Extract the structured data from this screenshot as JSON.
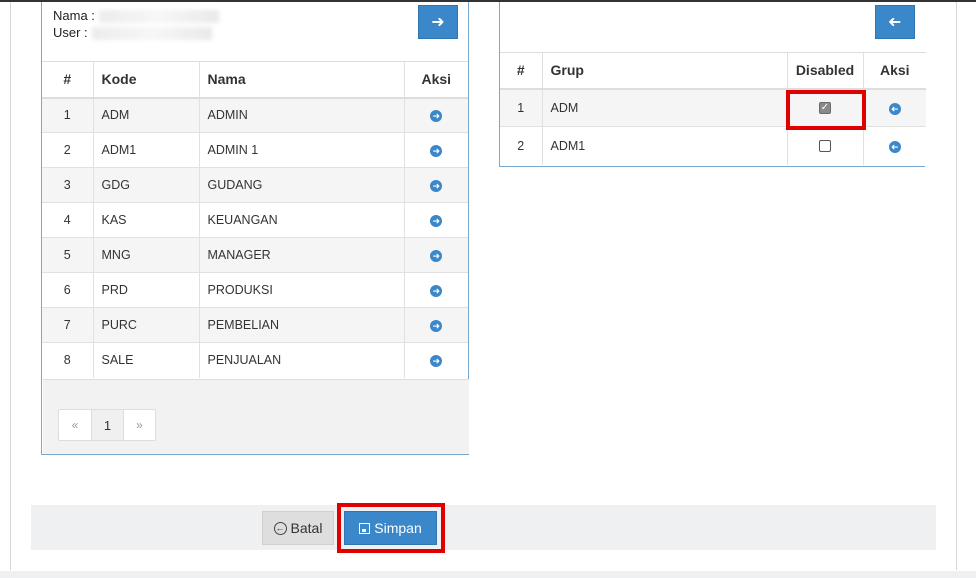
{
  "user_info": {
    "name_label": "Nama :",
    "user_label": "User :"
  },
  "left_panel": {
    "move_right_icon": "arrow-right",
    "columns": [
      "#",
      "Kode",
      "Nama",
      "Aksi"
    ],
    "rows": [
      {
        "no": "1",
        "kode": "ADM",
        "nama": "ADMIN"
      },
      {
        "no": "2",
        "kode": "ADM1",
        "nama": "ADMIN 1"
      },
      {
        "no": "3",
        "kode": "GDG",
        "nama": "GUDANG"
      },
      {
        "no": "4",
        "kode": "KAS",
        "nama": "KEUANGAN"
      },
      {
        "no": "5",
        "kode": "MNG",
        "nama": "MANAGER"
      },
      {
        "no": "6",
        "kode": "PRD",
        "nama": "PRODUKSI"
      },
      {
        "no": "7",
        "kode": "PURC",
        "nama": "PEMBELIAN"
      },
      {
        "no": "8",
        "kode": "SALE",
        "nama": "PENJUALAN"
      }
    ],
    "pagination": {
      "prev": "«",
      "current": "1",
      "next": "»"
    }
  },
  "right_panel": {
    "move_left_icon": "arrow-left",
    "columns": [
      "#",
      "Grup",
      "Disabled",
      "Aksi"
    ],
    "rows": [
      {
        "no": "1",
        "grup": "ADM",
        "disabled": true
      },
      {
        "no": "2",
        "grup": "ADM1",
        "disabled": false
      }
    ]
  },
  "actions": {
    "cancel_label": "Batal",
    "save_label": "Simpan"
  },
  "colors": {
    "primary": "#3a87c9",
    "highlight": "#e00000"
  }
}
